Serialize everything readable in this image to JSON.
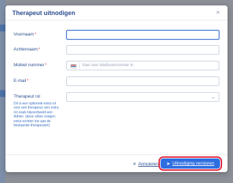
{
  "dialog": {
    "title": "Therapeut uitnodigen",
    "close_icon": "close-icon"
  },
  "form": {
    "voornaam": {
      "label": "Voornaam",
      "required": "*",
      "value": ""
    },
    "achternaam": {
      "label": "Achternaam",
      "required": "*",
      "value": ""
    },
    "mobiel": {
      "label": "Mobiel nummer",
      "required": "*",
      "placeholder": "Voer een telefoonnummer in",
      "country_icon": "netherlands-flag-icon"
    },
    "email": {
      "label": "E-mail",
      "required": "*",
      "value": ""
    },
    "rol": {
      "label": "Therapeut rol",
      "selected": "",
      "help": "Dit is een optionele extra rol voor een therapeut, een extra rol zoals bijvoorbeeld een Admin. (deze rollen voegen extra rechten toe aan de bestaande therapeuten)"
    }
  },
  "footer": {
    "cancel_label": "Annuleren",
    "send_label": "Uitnodiging versturen"
  },
  "colors": {
    "primary": "#2f6ee0",
    "title": "#2b4d8f",
    "required": "#e0334f",
    "highlight_outline": "#e0243b"
  }
}
